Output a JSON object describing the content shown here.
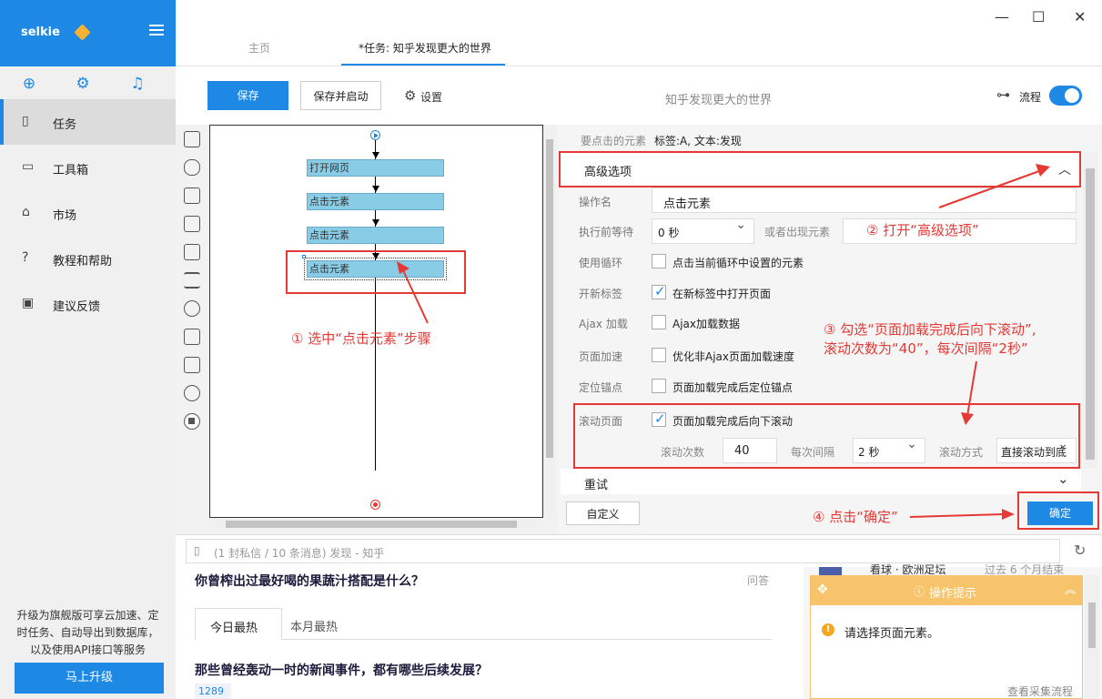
{
  "app": {
    "brand": "selkie"
  },
  "sidebar": {
    "items": [
      {
        "label": "任务",
        "icon": "document-icon"
      },
      {
        "label": "工具箱",
        "icon": "toolbox-icon"
      },
      {
        "label": "市场",
        "icon": "bag-icon"
      },
      {
        "label": "教程和帮助",
        "icon": "help-icon"
      },
      {
        "label": "建议反馈",
        "icon": "chat-icon"
      }
    ],
    "promo_lines": [
      "升级为旗舰版可享云加速、定",
      "时任务、自动导出到数据库，",
      "以及使用API接口等服务"
    ],
    "upgrade": "马上升级"
  },
  "window": {
    "minimize": "—",
    "maximize": "☐",
    "close": "✕"
  },
  "tabs": [
    "主页",
    "*任务: 知乎发现更大的世界"
  ],
  "toolbar": {
    "save": "保存",
    "save_start": "保存并启动",
    "settings": "设置",
    "task_title": "知乎发现更大的世界",
    "flow": "流程"
  },
  "flow": {
    "steps": [
      "打开网页",
      "点击元素",
      "点击元素",
      "点击元素"
    ]
  },
  "annotations": {
    "a1": "① 选中“点击元素”步骤",
    "a2": "② 打开“高级选项”",
    "a3_l1": "③ 勾选“页面加载完成后向下滚动”,",
    "a3_l2": "滚动次数为“40”，每次间隔“2秒”",
    "a4": "④ 点击“确定”"
  },
  "props": {
    "element_label": "要点击的元素",
    "element_value": "标签:A, 文本:发现",
    "advanced": "高级选项",
    "op_name_label": "操作名",
    "op_name_value": "点击元素",
    "wait_label": "执行前等待",
    "wait_value": "0 秒",
    "or_appear": "或者出现元素",
    "loop_label": "使用循环",
    "loop_text": "点击当前循环中设置的元素",
    "newtab_label": "开新标签",
    "newtab_text": "在新标签中打开页面",
    "ajax_label": "Ajax 加载",
    "ajax_text": "Ajax加载数据",
    "speed_label": "页面加速",
    "speed_text": "优化非Ajax页面加载速度",
    "anchor_label": "定位锚点",
    "anchor_text": "页面加载完成后定位锚点",
    "scroll_label": "滚动页面",
    "scroll_text": "页面加载完成后向下滚动",
    "scroll_count_label": "滚动次数",
    "scroll_count": "40",
    "interval_label": "每次间隔",
    "interval_value": "2 秒",
    "mode_label": "滚动方式",
    "mode_value": "直接滚动到底",
    "retry": "重试",
    "custom": "自定义",
    "confirm": "确定"
  },
  "browser": {
    "url_placeholder": "(1 封私信 / 10 条消息) 发现 - 知乎"
  },
  "feed": {
    "q1": "你曾榨出过最好喝的果蔬汁搭配是什么？",
    "q1_tag": "问答",
    "tab_today": "今日最热",
    "tab_month": "本月最热",
    "q2": "那些曾经轰动一时的新闻事件，都有哪些后续发展？",
    "votes": "1289",
    "partial": "看球 · 欧洲足坛",
    "partial2": "过去 6 个月结束"
  },
  "tip": {
    "title": "操作提示",
    "message": "请选择页面元素。",
    "footer": "查看采集流程"
  }
}
